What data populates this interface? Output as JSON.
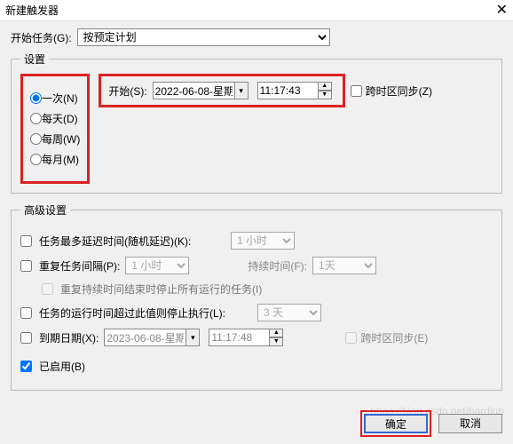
{
  "window": {
    "title": "新建触发器"
  },
  "begin": {
    "label": "开始任务(G):",
    "value": "按预定计划"
  },
  "settings": {
    "legend": "设置",
    "frequency": {
      "options": [
        {
          "label": "一次(N)",
          "checked": true
        },
        {
          "label": "每天(D)",
          "checked": false
        },
        {
          "label": "每周(W)",
          "checked": false
        },
        {
          "label": "每月(M)",
          "checked": false
        }
      ]
    },
    "start": {
      "label": "开始(S):",
      "date": "2022-06-08-星期",
      "time": "11:17:43"
    },
    "sync": {
      "label": "跨时区同步(Z)"
    }
  },
  "advanced": {
    "legend": "高级设置",
    "delay": {
      "label": "任务最多延迟时间(随机延迟)(K):",
      "value": "1 小时"
    },
    "repeat": {
      "label": "重复任务间隔(P):",
      "value": "1 小时",
      "duration_label": "持续时间(F):",
      "duration_value": "1天"
    },
    "stop_at_end": "重复持续时间结束时停止所有运行的任务(I)",
    "stop_after": {
      "label": "任务的运行时间超过此值则停止执行(L):",
      "value": "3 天"
    },
    "expire": {
      "label": "到期日期(X):",
      "date": "2023-06-08-星期",
      "time": "11:17:48",
      "sync_label": "跨时区同步(E)"
    },
    "enabled": {
      "label": "已启用(B)"
    }
  },
  "footer": {
    "ok": "确定",
    "cancel": "取消"
  },
  "watermark": "https://blog.csdn.net/hardiuh"
}
